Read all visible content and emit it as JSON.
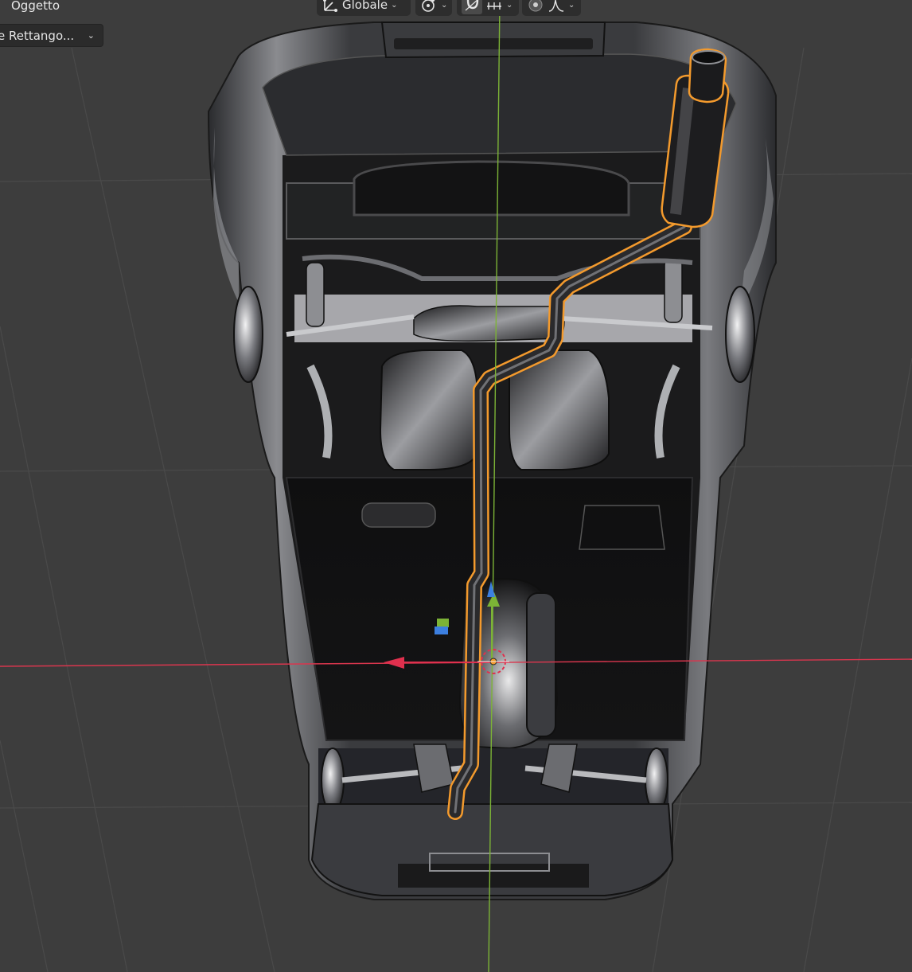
{
  "header": {
    "mode_menu_label": "Oggetto",
    "select_mode_label": "e Rettango..."
  },
  "toolbar": {
    "transform_orientation_label": "Globale",
    "snap_active": true,
    "proportional_editing": false
  },
  "colors": {
    "viewport_bg": "#3d3d3d",
    "selection_outline": "#f39a2d",
    "x_axis": "#d9364e",
    "y_axis": "#7cb336",
    "z_axis": "#3c7fe0",
    "header_bg": "#2b2b2b"
  },
  "icons": {
    "orientation": "transform-orientation-icon",
    "pivot": "pivot-point-icon",
    "snap": "snap-magnet-icon",
    "snap_increment": "snap-increment-icon",
    "proportional": "proportional-editing-icon",
    "falloff": "falloff-curve-icon"
  }
}
